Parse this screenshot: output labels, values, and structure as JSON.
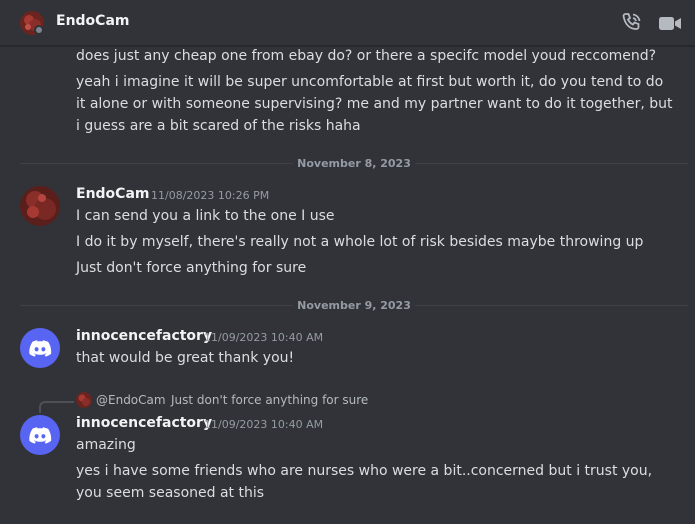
{
  "header": {
    "title": "EndoCam",
    "colors": {
      "status": "#80848e",
      "background": "#313338"
    }
  },
  "messages_top": {
    "line1": "does just any cheap one from ebay do? or there a specifc model youd reccomend?",
    "line2a": "yeah i imagine it will be super uncomfortable at first but worth it, do you tend to do",
    "line2b": "it alone or with someone supervising? me and my partner want to do it together, but",
    "line2c": "i guess are a bit scared of the risks haha"
  },
  "dividers": {
    "nov8": "November 8, 2023",
    "nov9": "November 9, 2023"
  },
  "group_endocam": {
    "username": "EndoCam",
    "timestamp": "11/08/2023 10:26 PM",
    "line1": "I can send you a link to the one I use",
    "line2": "I do it by myself, there's really not a whole lot of risk besides maybe throwing up",
    "line3": "Just don't force anything for sure"
  },
  "group_innocence1": {
    "username": "innocencefactory",
    "timestamp": "11/09/2023 10:40 AM",
    "line1": "that would be great thank you!"
  },
  "reply": {
    "author": "@EndoCam",
    "text": "Just don't force anything for sure"
  },
  "group_innocence2": {
    "username": "innocencefactory",
    "timestamp": "11/09/2023 10:40 AM",
    "line1": "amazing",
    "line2a": "yes i have some friends who are nurses who were a bit..concerned but i trust you,",
    "line2b": "you seem seasoned at this"
  },
  "colors": {
    "discord_blurple": "#5865f2",
    "endocam_avatar": "#8a2e2a"
  }
}
